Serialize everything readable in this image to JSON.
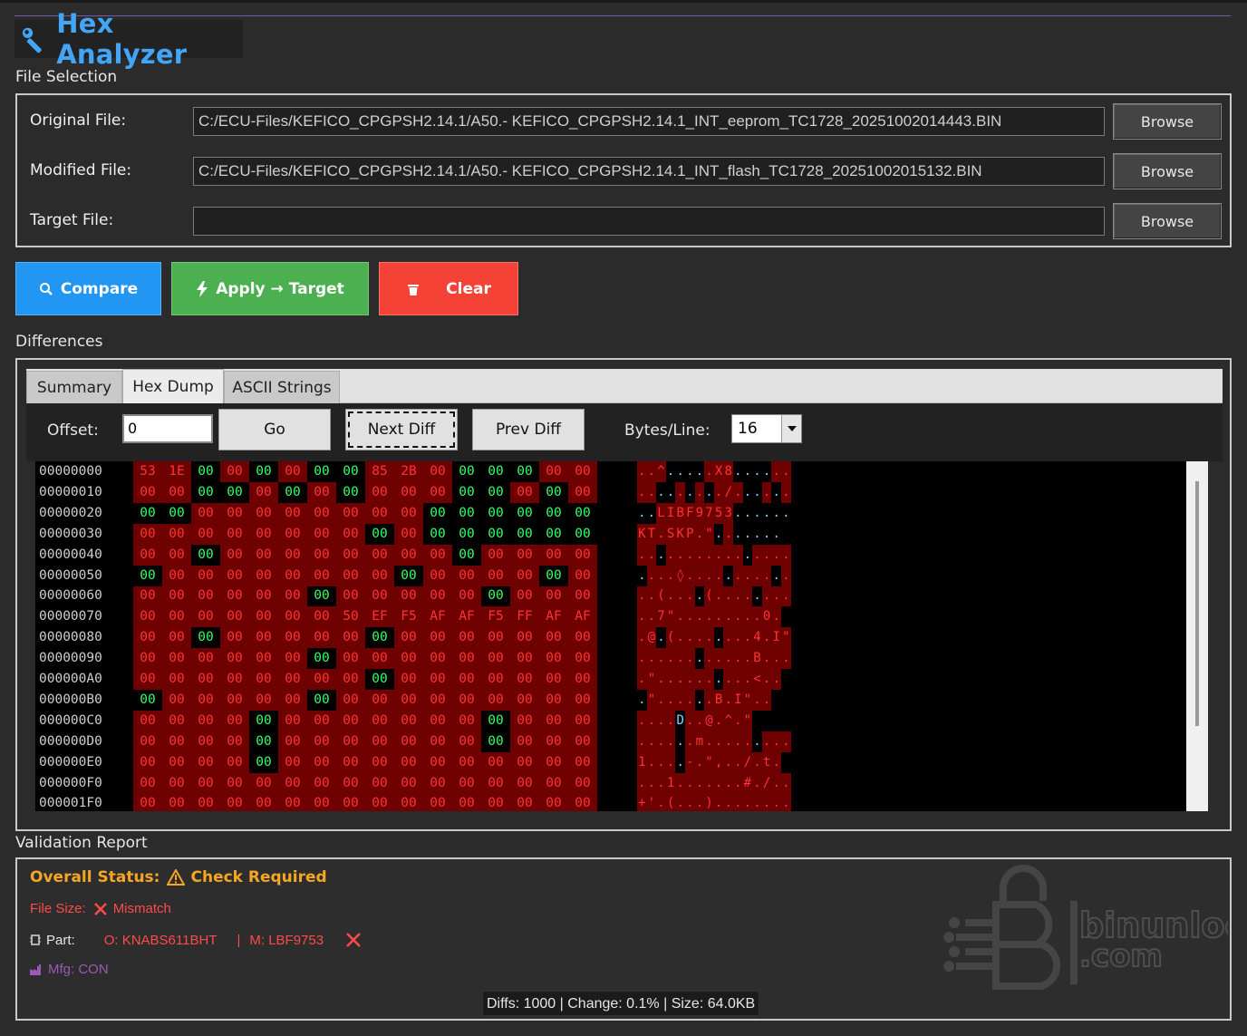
{
  "app": {
    "title": "Hex Analyzer",
    "icon": "wrench-icon"
  },
  "file_selection": {
    "heading": "File Selection",
    "original": {
      "label": "Original File:",
      "value": "C:/ECU-Files/KEFICO_CPGPSH2.14.1/A50.- KEFICO_CPGPSH2.14.1_INT_eeprom_TC1728_20251002014443.BIN"
    },
    "modified": {
      "label": "Modified File:",
      "value": "C:/ECU-Files/KEFICO_CPGPSH2.14.1/A50.- KEFICO_CPGPSH2.14.1_INT_flash_TC1728_20251002015132.BIN"
    },
    "target": {
      "label": "Target File:",
      "value": ""
    },
    "browse_label": "Browse"
  },
  "actions": {
    "compare": "Compare",
    "apply": "Apply → Target",
    "clear": "Clear",
    "compare_color": "#2196f3",
    "apply_color": "#4caf50",
    "clear_color": "#f44336"
  },
  "differences": {
    "heading": "Differences",
    "tabs": [
      "Summary",
      "Hex Dump",
      "ASCII Strings"
    ],
    "active_tab": "Hex Dump",
    "offset_label": "Offset:",
    "offset_value": "0",
    "go": "Go",
    "next": "Next Diff",
    "prev": "Prev Diff",
    "bytes_label": "Bytes/Line:",
    "bytes_value": "16",
    "rows": [
      {
        "offset": "00000000",
        "hex": "53 1E 00 00 00 00 00 00 85 2B 00 00 00 00 00 00",
        "mask": "DDSDSDSSDDDSSSDD",
        "ascii": "..^.....X8......",
        "amask": "DDDSSSSDDDSSSSDD"
      },
      {
        "offset": "00000010",
        "hex": "00 00 00 00 00 00 00 00 00 00 00 00 00 00 00 00",
        "mask": "DDSSDSDSDDDSSDSD",
        "ascii": "........./......",
        "amask": "DDSSDSDSDDDSSDSD"
      },
      {
        "offset": "00000020",
        "hex": "00 00 00 00 00 00 00 00 00 00 00 00 00 00 00 00",
        "mask": "SSDDDDDDDDSSSSSS",
        "ascii": "..LIBF9753......",
        "amask": "SSDDDDDDDDSSSSSS"
      },
      {
        "offset": "00000030",
        "hex": "00 00 00 00 00 00 00 00 00 00 00 00 00 00 00 00",
        "mask": "DDDDDDDDSDSSSSSS",
        "ascii": "KT.SKP.\".......",
        "amask": "DDDDDDDDSDSSSSSS"
      },
      {
        "offset": "00000040",
        "hex": "00 00 00 00 00 00 00 00 00 00 00 00 00 00 00 00",
        "mask": "DDSDDDDDDDDSDDDD",
        "ascii": "................",
        "amask": "DDSDDDDDDDDSDDDD"
      },
      {
        "offset": "00000050",
        "hex": "00 00 00 00 00 00 00 00 00 00 00 00 00 00 00 00",
        "mask": "SDDDDDDDDSDDDDSD",
        "ascii": "....◊...........",
        "amask": "SDDDDDDDDSDDDDSD"
      },
      {
        "offset": "00000060",
        "hex": "00 00 00 00 00 00 00 00 00 00 00 00 00 00 00 00",
        "mask": "DDDDDDSDDDDDSDDD",
        "ascii": "..(....(........",
        "amask": "DDDDDDSDDDDDSDDD"
      },
      {
        "offset": "00000070",
        "hex": "00 00 00 00 00 00 00 50 EF F5 AF AF F5 FF AF AF",
        "mask": "DDDDDDDDDDDDDDDD",
        "ascii": "..7\".........0.",
        "amask": "DDDDDDDDDDDDDDDD"
      },
      {
        "offset": "00000080",
        "hex": "00 00 00 00 00 00 00 00 00 00 00 00 00 00 00 00",
        "mask": "DDSDDDDDSDDDDDDD",
        "ascii": ".@.(........4.I\"",
        "amask": "DDSDDDDDSDDDDDDD"
      },
      {
        "offset": "00000090",
        "hex": "00 00 00 00 00 00 00 00 00 00 00 00 00 00 00 00",
        "mask": "DDDDDDSDDDDDDDDD",
        "ascii": "............B...(",
        "amask": "DDDDDDSDDDDDDDDD"
      },
      {
        "offset": "000000A0",
        "hex": "00 00 00 00 00 00 00 00 00 00 00 00 00 00 00 00",
        "mask": "DDDDDDDDSDDDDDDD",
        "ascii": ".\"..........<..",
        "amask": "DDDDDDDDSDDDDDDD"
      },
      {
        "offset": "000000B0",
        "hex": "00 00 00 00 00 00 00 00 00 00 00 00 00 00 00 00",
        "mask": "SDDDDDSDDDDDDDDD",
        "ascii": ".\"......B.I\"..",
        "amask": "SDDDDDSDDDDDDDDD"
      },
      {
        "offset": "000000C0",
        "hex": "00 00 00 00 00 00 00 00 00 00 00 00 00 00 00 00",
        "mask": "DDDDSDDDDDDDSDDD",
        "ascii": "....D..@.^.\"",
        "amask": "DDDDSDDDDDDDSDDD"
      },
      {
        "offset": "000000D0",
        "hex": "00 00 00 00 00 00 00 00 00 00 00 00 00 00 00 00",
        "mask": "DDDDSDDDDDDDSDDD",
        "ascii": "......m.........",
        "amask": "DDDDSDDDDDDDSDDD"
      },
      {
        "offset": "000000E0",
        "hex": "00 00 00 00 00 00 00 00 00 00 00 00 00 00 00 00",
        "mask": "DDDDSDDDDDDDDDDD",
        "ascii": "1....-.\",../.t.",
        "amask": "DDDDSDDDDDDDDDDD"
      },
      {
        "offset": "000000F0",
        "hex": "00 00 00 00 00 00 00 00 00 00 00 00 00 00 00 00",
        "mask": "DDDDDDDDDDDDDDDD",
        "ascii": "...1.......#./..",
        "amask": "DDDDDDDDDDDDDDDD"
      },
      {
        "offset": "000001F0",
        "hex": "00 00 00 00 00 00 00 00 00 00 00 00 00 00 00 00",
        "mask": "DDDDDDDDDDDDDDDD",
        "ascii": "+'.(...)........",
        "amask": "DDDDDDDDDDDDDDDD"
      }
    ]
  },
  "validation": {
    "heading": "Validation Report",
    "overall_label": "Overall Status:",
    "overall_value": "Check Required",
    "file_size_label": "File Size:",
    "file_size_value": "Mismatch",
    "part_label": "Part:",
    "part_original": "O: KNABS611BHT",
    "part_sep": "|",
    "part_modified": "M: LBF9753",
    "mfg": "Mfg: CON",
    "status": "Diffs: 1000 | Change: 0.1% | Size: 64.0KB",
    "logo_text_1": "binunlock",
    "logo_text_2": ".com",
    "warn_color": "#f5a623",
    "error_color": "#ff4a4a",
    "mfg_color": "#9b59b6"
  }
}
